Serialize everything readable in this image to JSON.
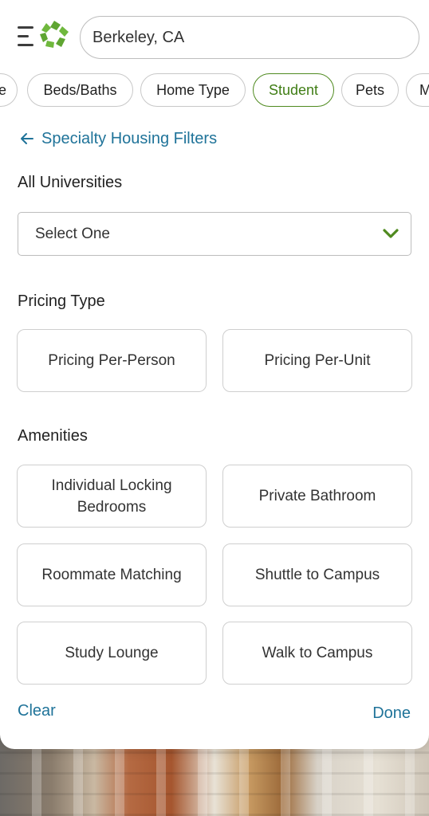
{
  "header": {
    "search_value": "Berkeley, CA"
  },
  "filter_chips": [
    {
      "label": "e",
      "active": false
    },
    {
      "label": "Beds/Baths",
      "active": false
    },
    {
      "label": "Home Type",
      "active": false
    },
    {
      "label": "Student",
      "active": true
    },
    {
      "label": "Pets",
      "active": false
    },
    {
      "label": "M",
      "active": false
    }
  ],
  "panel": {
    "back_label": "Specialty Housing Filters",
    "universities": {
      "title": "All Universities",
      "selected": "Select One"
    },
    "pricing": {
      "title": "Pricing Type",
      "options": [
        "Pricing Per-Person",
        "Pricing Per-Unit"
      ]
    },
    "amenities": {
      "title": "Amenities",
      "options": [
        "Individual Locking Bedrooms",
        "Private Bathroom",
        "Roommate Matching",
        "Shuttle to Campus",
        "Study Lounge",
        "Walk to Campus"
      ]
    },
    "clear_label": "Clear",
    "done_label": "Done"
  },
  "colors": {
    "accent_green": "#4f8a1f",
    "link_blue": "#1f7399"
  }
}
